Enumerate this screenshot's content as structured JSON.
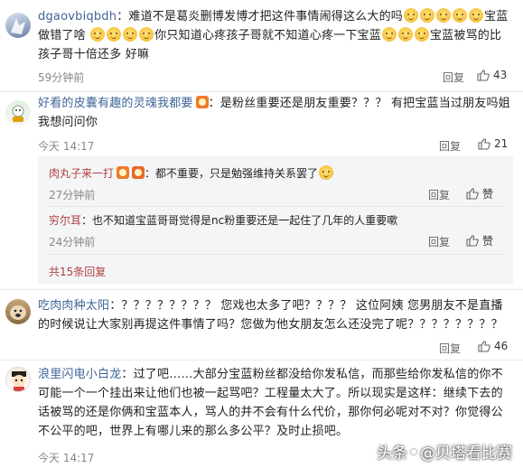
{
  "comments": [
    {
      "user": "dgaovbiqbdh",
      "text1": "：难道不是葛炎删博发博才把这件事情闹得这么大的吗",
      "text2": "宝蓝做错了啥",
      "text3": "你只知道心疼孩子哥就不知道心疼一下宝蓝",
      "text4": "宝蓝被骂的比孩子哥十倍还多",
      "text5": "好嘛",
      "time": "59分钟前",
      "reply": "回复",
      "likes": "43"
    },
    {
      "user": "好看的皮囊有趣的灵魂我都要",
      "text": "：是粉丝重要还是朋友重要？？？ 有把宝蓝当过朋友吗姐我想问问你",
      "time": "今天 14:17",
      "reply": "回复",
      "likes": "21",
      "sub_replies": [
        {
          "user": "肉丸子来一打",
          "text": "：都不重要，只是勉强维持关系罢了",
          "time": "27分钟前",
          "reply": "回复",
          "like": "赞"
        },
        {
          "user": "穷尔耳",
          "text": "：也不知道宝蓝哥哥觉得是nc粉重要还是一起住了几年的人重要嗽",
          "time": "24分钟前",
          "reply": "回复",
          "like": "赞"
        }
      ],
      "more_replies": "共15条回复"
    },
    {
      "user": "吃肉肉种太阳",
      "text": "：？？？？？？？？ 您戏也太多了吧？？？？ 这位阿姨 您男朋友不是直播的时候说让大家别再提这件事情了吗？您做为他女朋友怎么还没完了呢？？？？？？？？",
      "reply": "回复",
      "likes": "46"
    },
    {
      "user": "浪里闪电小白龙",
      "text": "：过了吧……大部分宝蓝粉丝都没给你发私信，而那些给你发私信的你不可能一个一个挂出来让他们也被一起骂吧？工程量太大了。所以现实是这样：继续下去的话被骂的还是你俩和宝蓝本人，骂人的并不会有什么代价，那你何必呢对不对？你觉得公不公平的吧，世界上有哪儿来的那么多公平？及时止损吧。",
      "time": "今天 14:17"
    }
  ],
  "watermark": {
    "prefix": "头条",
    "handle": "@贝塔看比赛"
  }
}
